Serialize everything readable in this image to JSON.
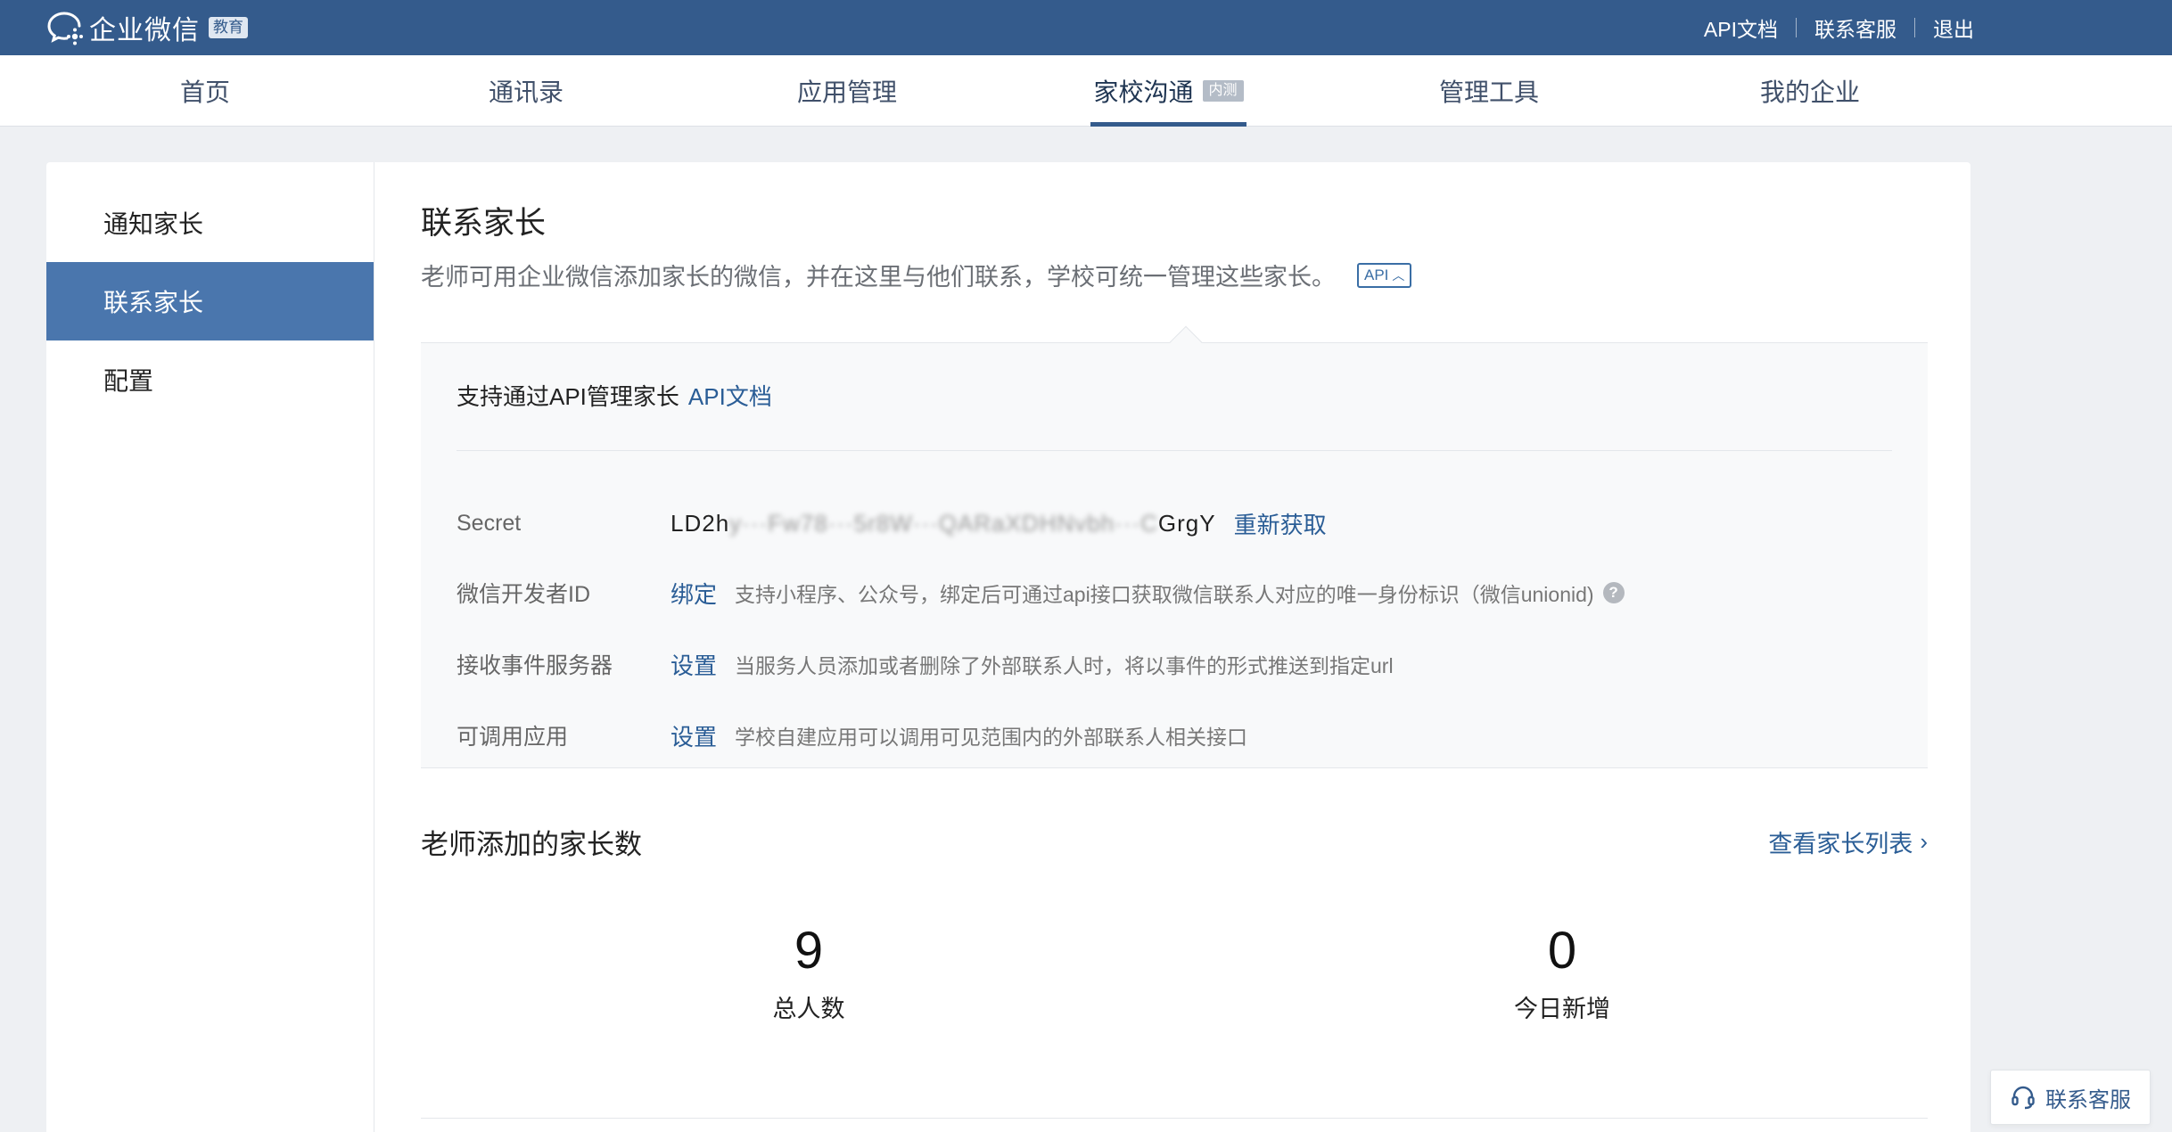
{
  "header": {
    "brand": "企业微信",
    "brand_badge": "教育",
    "links": [
      "API文档",
      "联系客服",
      "退出"
    ]
  },
  "nav": {
    "tabs": [
      {
        "label": "首页"
      },
      {
        "label": "通讯录"
      },
      {
        "label": "应用管理"
      },
      {
        "label": "家校沟通",
        "badge": "内测",
        "active": true
      },
      {
        "label": "管理工具"
      },
      {
        "label": "我的企业"
      }
    ]
  },
  "sidebar": {
    "items": [
      {
        "label": "通知家长"
      },
      {
        "label": "联系家长",
        "active": true
      },
      {
        "label": "配置"
      }
    ]
  },
  "main": {
    "title": "联系家长",
    "description": "老师可用企业微信添加家长的微信，并在这里与他们联系，学校可统一管理这些家长。",
    "api_toggle": "API",
    "api_panel": {
      "heading": "支持通过API管理家长",
      "doc_link": "API文档",
      "secret_label": "Secret",
      "secret_visible_start": "LD2h",
      "secret_masked": "y···Fw78···5r8W···QARaXDHNvbh···C",
      "secret_visible_end": "GrgY",
      "refresh_link": "重新获取",
      "rows": [
        {
          "label": "微信开发者ID",
          "action": "绑定",
          "hint": "支持小程序、公众号，绑定后可通过api接口获取微信联系人对应的唯一身份标识（微信unionid)"
        },
        {
          "label": "接收事件服务器",
          "action": "设置",
          "hint": "当服务人员添加或者删除了外部联系人时，将以事件的形式推送到指定url"
        },
        {
          "label": "可调用应用",
          "action": "设置",
          "hint": "学校自建应用可以调用可见范围内的外部联系人相关接口"
        }
      ]
    },
    "stats": {
      "title": "老师添加的家长数",
      "view_list": "查看家长列表",
      "items": [
        {
          "value": "9",
          "caption": "总人数"
        },
        {
          "value": "0",
          "caption": "今日新增"
        }
      ]
    }
  },
  "floating": {
    "support": "联系客服"
  },
  "colors": {
    "topbar": "#345b8c",
    "accent": "#4a76ad",
    "link": "#2a5d96"
  }
}
